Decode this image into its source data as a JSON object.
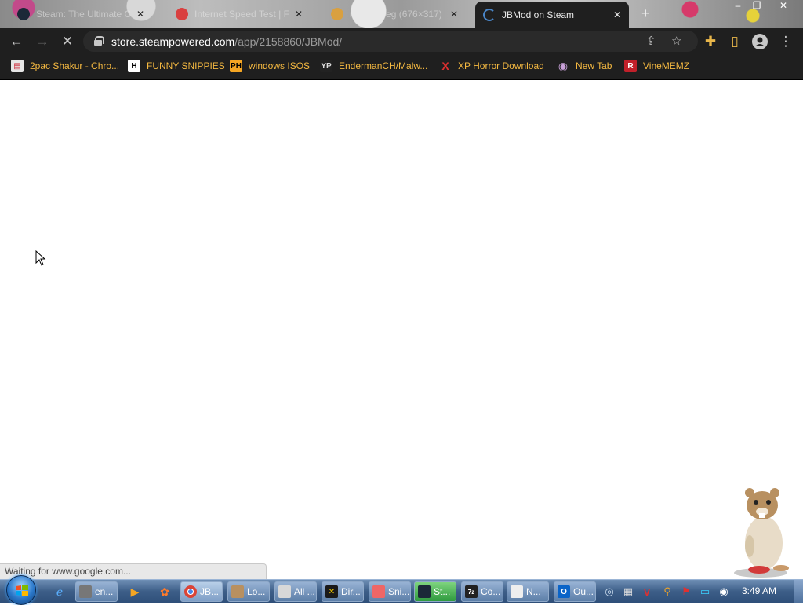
{
  "browser": {
    "tabs": [
      {
        "title": "Steam: The Ultimate On...",
        "active": false
      },
      {
        "title": "Internet Speed Test | Fas...",
        "active": false
      },
      {
        "title": "meme.jpeg (676×317)",
        "active": false
      },
      {
        "title": "JBMod on Steam",
        "active": true
      }
    ],
    "new_tab_label": "+",
    "window_controls": {
      "minimize": "–",
      "restore": "❐",
      "close": "✕"
    },
    "toolbar": {
      "back": "←",
      "forward": "→",
      "stop": "✕",
      "url_host": "store.steampowered.com",
      "url_path": "/app/2158860/JBMod/",
      "share": "⇪",
      "star": "☆",
      "extensions": "✚",
      "sidepanel": "▯",
      "menu": "⋮"
    },
    "bookmarks": [
      {
        "label": "2pac Shakur - Chro...",
        "icon": "folder-icon",
        "glyph": "▤"
      },
      {
        "label": "FUNNY SNIPPIES",
        "icon": "h-icon",
        "glyph": "H"
      },
      {
        "label": "windows ISOS",
        "icon": "ph-icon",
        "glyph": "PH"
      },
      {
        "label": "EndermanCH/Malw...",
        "icon": "yp-icon",
        "glyph": "YP"
      },
      {
        "label": "XP Horror Download",
        "icon": "x-icon",
        "glyph": "X"
      },
      {
        "label": "New Tab",
        "icon": "globe-icon",
        "glyph": "◉"
      },
      {
        "label": "VineMEMZ",
        "icon": "r-icon",
        "glyph": "R"
      }
    ]
  },
  "page": {
    "status_text": "Waiting for www.google.com..."
  },
  "taskbar": {
    "tasks": [
      {
        "label": "en...",
        "icon": "notebook-icon"
      },
      {
        "label": "JB...",
        "icon": "chrome-icon"
      },
      {
        "label": "Lo...",
        "icon": "hamster-icon"
      },
      {
        "label": "All ...",
        "icon": "window-icon"
      },
      {
        "label": "Dir...",
        "icon": "directx-icon"
      },
      {
        "label": "Sni...",
        "icon": "snipping-icon"
      },
      {
        "label": "St...",
        "icon": "steam-icon"
      },
      {
        "label": "Co...",
        "icon": "7zip-icon"
      },
      {
        "label": "N...",
        "icon": "notepad-icon"
      },
      {
        "label": "Ou...",
        "icon": "outlook-icon"
      }
    ],
    "clock": "3:49 AM"
  },
  "colors": {
    "toolbar_bg": "#1f1f1f",
    "bookmark_text": "#f5b941",
    "taskbar_top": "#6f8fb5"
  }
}
